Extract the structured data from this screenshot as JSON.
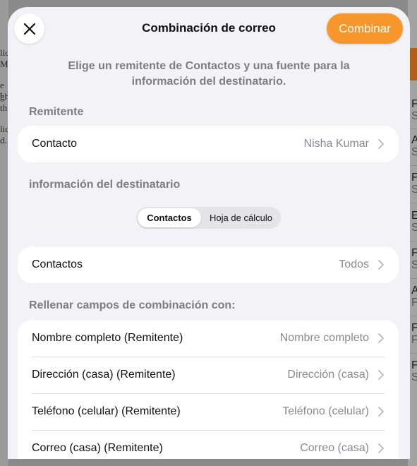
{
  "background": {
    "left_fragments": [
      "lic",
      "M",
      "e t",
      "gh",
      "th",
      "lic",
      "d."
    ],
    "right_rows": [
      {
        "main": "F",
        "sub": "S"
      },
      {
        "main": "A",
        "sub": "S"
      },
      {
        "main": "F",
        "sub": "S"
      },
      {
        "main": "E",
        "sub": "S"
      },
      {
        "main": "F",
        "sub": "S"
      },
      {
        "main": "A",
        "sub": "F"
      },
      {
        "main": "F",
        "sub": "F"
      },
      {
        "main": "F",
        "sub": "S"
      }
    ]
  },
  "sheet": {
    "title": "Combinación de correo",
    "combine_label": "Combinar",
    "description": "Elige un remitente de Contactos y una fuente para la información del destinatario.",
    "sender_section": "Remitente",
    "sender_row": {
      "label": "Contacto",
      "value": "Nisha Kumar"
    },
    "recipient_section": "información del destinatario",
    "segments": [
      "Contactos",
      "Hoja de cálculo"
    ],
    "selected_segment": "Contactos",
    "contacts_row": {
      "label": "Contactos",
      "value": "Todos"
    },
    "fields_section": "Rellenar campos de combinación con:",
    "fields": [
      {
        "label": "Nombre completo (Remitente)",
        "value": "Nombre completo"
      },
      {
        "label": "Dirección (casa) (Remitente)",
        "value": "Dirección (casa)"
      },
      {
        "label": "Teléfono (celular) (Remitente)",
        "value": "Teléfono (celular)"
      },
      {
        "label": "Correo (casa) (Remitente)",
        "value": "Correo (casa)"
      }
    ]
  },
  "colors": {
    "accent": "#f7962a",
    "sheet_bg": "#f2f2f7",
    "secondary_text": "#8a8a8e"
  },
  "icons": {
    "close": "close-icon",
    "chevron": "chevron-right-icon"
  }
}
